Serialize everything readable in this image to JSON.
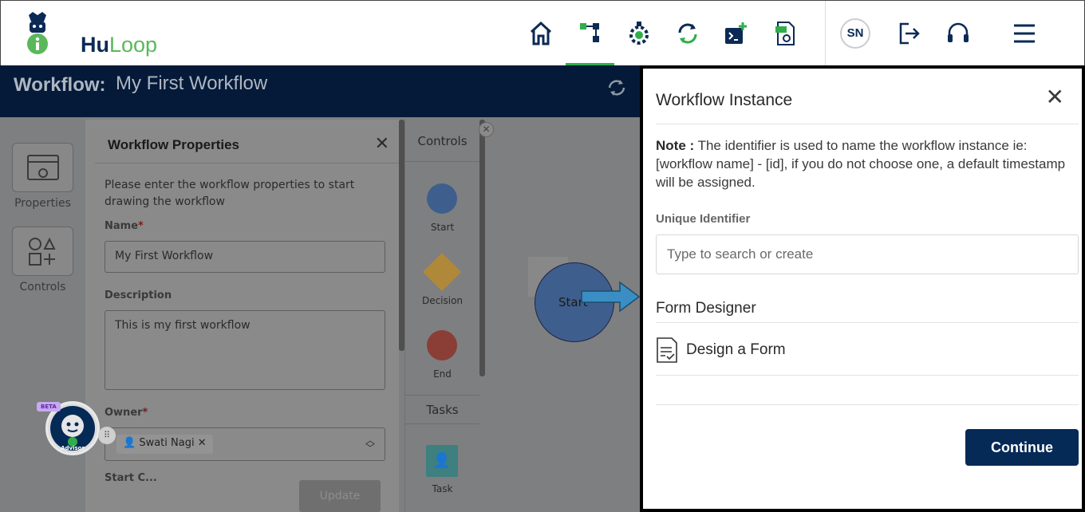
{
  "app": {
    "brand_hu": "Hu",
    "brand_loop": "Loop",
    "user_initials": "SN"
  },
  "nav": {
    "icons": [
      "home-icon",
      "workflow-icon",
      "bot-gear-icon",
      "sync-icon",
      "terminal-plus-icon",
      "pdf-settings-icon"
    ],
    "active": "workflow-icon",
    "right_icons": [
      "logout-icon",
      "headset-icon",
      "menu-icon"
    ]
  },
  "header": {
    "label": "Workflow:",
    "name": "My First Workflow"
  },
  "sidebar": {
    "properties_label": "Properties",
    "controls_label": "Controls"
  },
  "properties_panel": {
    "title": "Workflow Properties",
    "help": "Please enter the workflow properties to start drawing the workflow",
    "name_label": "Name",
    "name_value": "My First Workflow",
    "description_label": "Description",
    "description_value": "This is my first workflow",
    "owner_label": "Owner",
    "owner_value": "Swati Nagi",
    "next_label_partial": "Start C...",
    "update_label": "Update"
  },
  "controls_panel": {
    "title": "Controls",
    "items": [
      {
        "label": "Start",
        "color": "#3e5f8d"
      },
      {
        "label": "Decision",
        "color": "#b0883a"
      },
      {
        "label": "End",
        "color": "#8a3e36"
      }
    ],
    "tasks_title": "Tasks",
    "task_label": "Task"
  },
  "canvas": {
    "start_node_label": "Start"
  },
  "advisor": {
    "beta": "BETA",
    "label": "Advisor"
  },
  "modal": {
    "title": "Workflow Instance",
    "note_bold": "Note :",
    "note_text": " The identifier is used to name the workflow instance ie: [workflow name] - [id], if you do not choose one, a default timestamp will be assigned.",
    "uid_label": "Unique Identifier",
    "uid_placeholder": "Type to search or create",
    "uid_value": "",
    "form_designer_title": "Form Designer",
    "design_form_label": "Design a Form",
    "continue_label": "Continue"
  },
  "colors": {
    "brand_navy": "#062a56",
    "brand_green": "#2fae4b",
    "highlight_arrow": "#3a8ec4"
  }
}
